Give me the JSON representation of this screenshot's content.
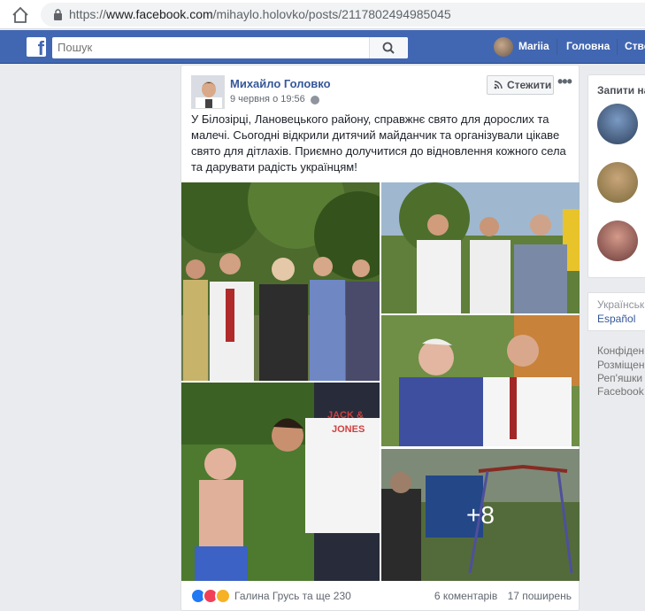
{
  "browser": {
    "url_prefix": "https://",
    "url_host": "www.facebook.com",
    "url_path": "/mihaylo.holovko/posts/2117802494985045"
  },
  "topbar": {
    "search_placeholder": "Пошук",
    "user_name": "Mariia",
    "home_label": "Головна",
    "create_label": "Ство"
  },
  "post": {
    "author": "Михайло Головко",
    "time": "9 червня о 19:56",
    "follow_label": "Стежити",
    "more_label": "•••",
    "text": "У Білозірці, Лановецького району, справжнє свято для дорослих та малечі. Сьогодні відкрили дитячий майданчик та організували цікаве свято для дітлахів. Приємно долучитися до відновлення кожного села та дарувати радість українцям!",
    "more_photos": "+8",
    "reactions_names": "Галина Грусь та ще 230",
    "comments": "6 коментарів",
    "shares": "17 поширень",
    "shirt_text_1": "JACK &",
    "shirt_text_2": "JONES"
  },
  "sidebar": {
    "requests_title": "Запити на",
    "lang_current": "Українська",
    "lang_alt": "Español",
    "footer": [
      "Конфіден",
      "Розміщен",
      "Реп'яшки",
      "Facebook"
    ]
  },
  "colors": {
    "fb_blue": "#4267b2",
    "link_blue": "#365899"
  }
}
